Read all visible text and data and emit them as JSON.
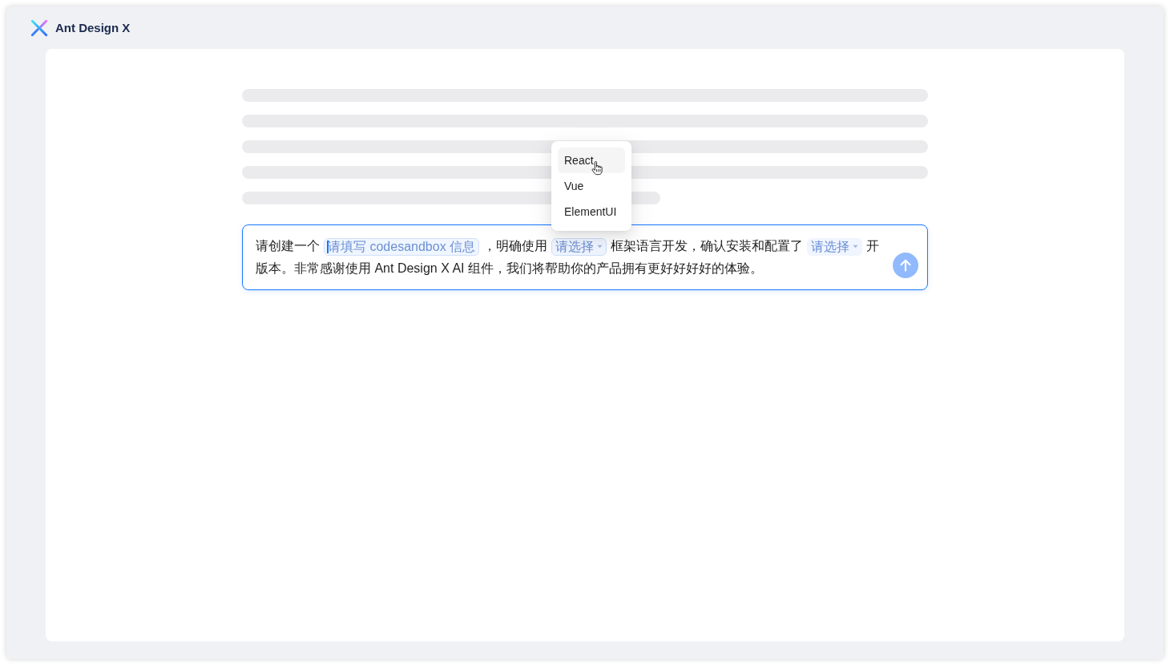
{
  "app": {
    "title": "Ant Design X"
  },
  "skeleton_lines": [
    {
      "kind": "full"
    },
    {
      "kind": "full"
    },
    {
      "kind": "full"
    },
    {
      "kind": "full"
    },
    {
      "kind": "short"
    }
  ],
  "sender": {
    "parts": [
      {
        "kind": "text",
        "text": "请创建一个"
      },
      {
        "kind": "input",
        "placeholder": "请填写 codesandbox 信息",
        "focused": true
      },
      {
        "kind": "text",
        "text": "，明确使用"
      },
      {
        "kind": "select",
        "placeholder": "请选择",
        "open": true,
        "options": [
          {
            "label": "React",
            "hovered": true
          },
          {
            "label": "Vue",
            "hovered": false
          },
          {
            "label": "ElementUI",
            "hovered": false
          }
        ]
      },
      {
        "kind": "text",
        "text": "框架语言开发，确认安装和配置了"
      },
      {
        "kind": "select",
        "placeholder": "请选择",
        "open": false
      },
      {
        "kind": "text",
        "text": "开版本。非常感谢使用 Ant Design X AI 组件，我们将帮助你的产品拥有更好好好好的体验。"
      }
    ],
    "send_button": {
      "disabled": true
    }
  }
}
